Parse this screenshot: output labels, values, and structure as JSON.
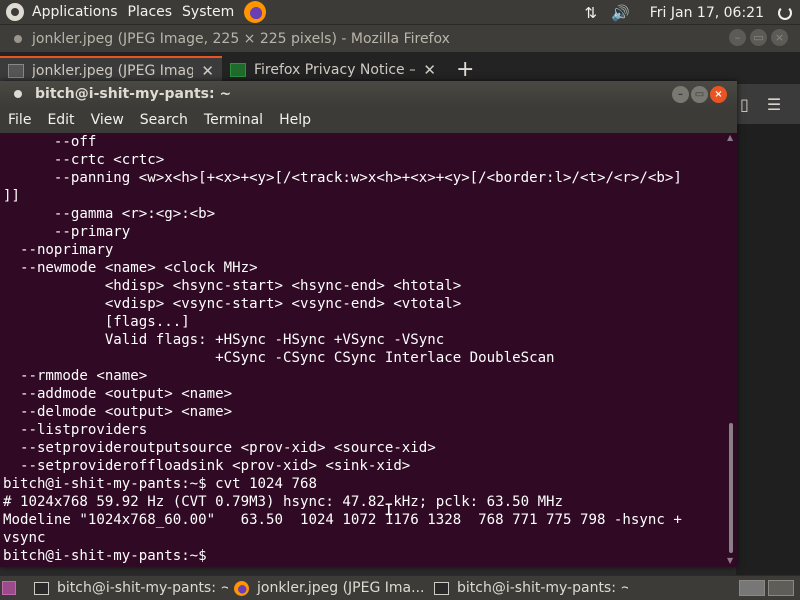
{
  "top_panel": {
    "applications": "Applications",
    "places": "Places",
    "system": "System",
    "clock": "Fri Jan 17, 06:21"
  },
  "firefox": {
    "title": "jonkler.jpeg (JPEG Image, 225 × 225 pixels) - Mozilla Firefox",
    "tabs": [
      {
        "label": "jonkler.jpeg (JPEG Image"
      },
      {
        "label": "Firefox Privacy Notice —"
      }
    ]
  },
  "terminal": {
    "title": "bitch@i-shit-my-pants: ~",
    "menu": [
      "File",
      "Edit",
      "View",
      "Search",
      "Terminal",
      "Help"
    ],
    "lines": [
      "      --off",
      "      --crtc <crtc>",
      "      --panning <w>x<h>[+<x>+<y>[/<track:w>x<h>+<x>+<y>[/<border:l>/<t>/<r>/<b>]",
      "]]",
      "      --gamma <r>:<g>:<b>",
      "      --primary",
      "  --noprimary",
      "  --newmode <name> <clock MHz>",
      "            <hdisp> <hsync-start> <hsync-end> <htotal>",
      "            <vdisp> <vsync-start> <vsync-end> <vtotal>",
      "            [flags...]",
      "            Valid flags: +HSync -HSync +VSync -VSync",
      "                         +CSync -CSync CSync Interlace DoubleScan",
      "  --rmmode <name>",
      "  --addmode <output> <name>",
      "  --delmode <output> <name>",
      "  --listproviders",
      "  --setprovideroutputsource <prov-xid> <source-xid>",
      "  --setprovideroffloadsink <prov-xid> <sink-xid>",
      "bitch@i-shit-my-pants:~$ cvt 1024 768",
      "# 1024x768 59.92 Hz (CVT 0.79M3) hsync: 47.82 kHz; pclk: 63.50 MHz",
      "Modeline \"1024x768_60.00\"   63.50  1024 1072 1176 1328  768 771 775 798 -hsync +",
      "vsync",
      "bitch@i-shit-my-pants:~$ "
    ]
  },
  "taskbar": {
    "tasks": [
      {
        "label": "bitch@i-shit-my-pants: ~"
      },
      {
        "label": "jonkler.jpeg (JPEG Ima..."
      },
      {
        "label": "bitch@i-shit-my-pants: ~"
      }
    ]
  }
}
